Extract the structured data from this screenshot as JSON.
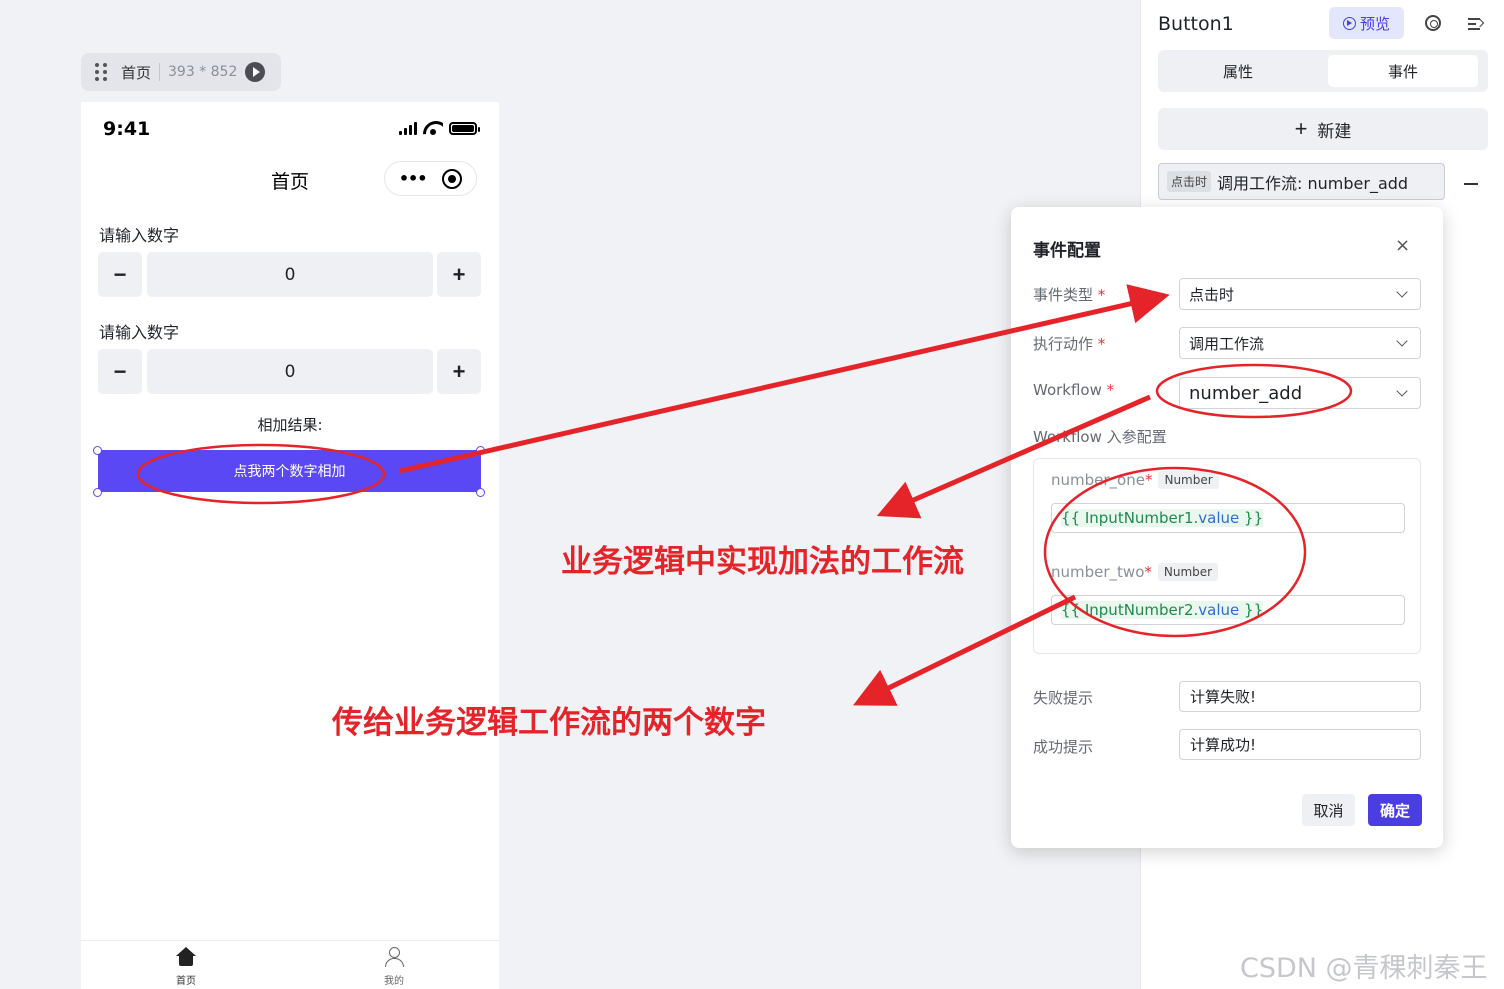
{
  "page_pill": {
    "name": "首页",
    "size": "393 * 852"
  },
  "phone": {
    "time": "9:41",
    "nav_title": "首页",
    "capsule_dots": "•••",
    "field1": {
      "label": "请输入数字",
      "value": "0",
      "minus": "−",
      "plus": "+"
    },
    "field2": {
      "label": "请输入数字",
      "value": "0",
      "minus": "−",
      "plus": "+"
    },
    "result_label": "相加结果:",
    "button_label": "点我两个数字相加",
    "tabs": [
      {
        "label": "首页"
      },
      {
        "label": "我的"
      }
    ]
  },
  "right_panel": {
    "title": "Button1",
    "preview_label": "预览",
    "tabs": [
      {
        "label": "属性"
      },
      {
        "label": "事件"
      }
    ],
    "new_label": "新建",
    "new_plus": "+",
    "event_tag": "点击时",
    "event_text": "调用工作流: number_add"
  },
  "modal": {
    "title": "事件配置",
    "close": "×",
    "event_type": {
      "label": "事件类型",
      "value": "点击时"
    },
    "action": {
      "label": "执行动作",
      "value": "调用工作流"
    },
    "workflow": {
      "label": "Workflow",
      "value": "number_add"
    },
    "params_label": "Workflow 入参配置",
    "params": [
      {
        "name": "number_one",
        "type": "Number",
        "open": "{{ ",
        "obj": "InputNumber1.",
        "prop": "value",
        "close": " }}"
      },
      {
        "name": "number_two",
        "type": "Number",
        "open": "{{ ",
        "obj": "InputNumber2.",
        "prop": "value",
        "close": " }}"
      }
    ],
    "fail": {
      "label": "失败提示",
      "value": "计算失败!"
    },
    "success": {
      "label": "成功提示",
      "value": "计算成功!"
    },
    "cancel_label": "取消",
    "ok_label": "确定",
    "required_mark": "*"
  },
  "annotations": {
    "text1": "业务逻辑中实现加法的工作流",
    "text2": "传给业务逻辑工作流的两个数字",
    "color": "#e5242a"
  },
  "watermark": "CSDN @青稞刺秦王",
  "colors": {
    "accent": "#5a48f5",
    "modal_primary": "#4a3ee0",
    "preview_bg": "#e4e6fb"
  }
}
